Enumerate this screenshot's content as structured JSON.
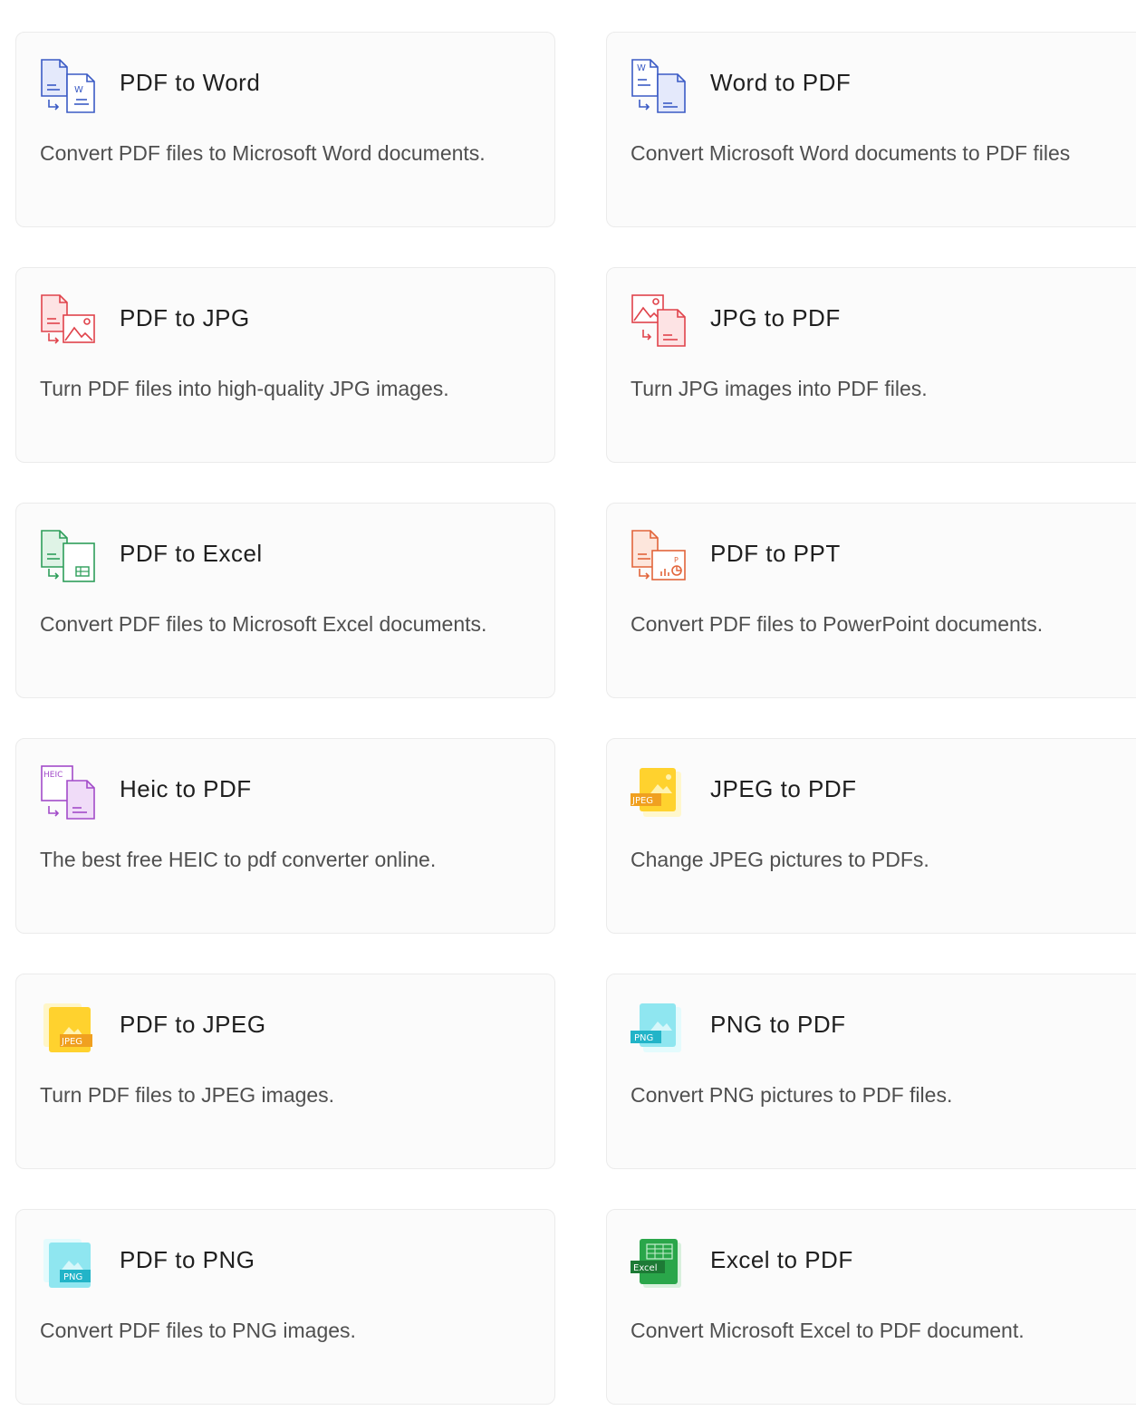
{
  "tools": [
    {
      "title": "PDF to Word",
      "description": "Convert PDF files to Microsoft Word documents.",
      "icon": "pdf-to-word-icon",
      "color": "#3b5bc5"
    },
    {
      "title": "Word to PDF",
      "description": "Convert Microsoft Word documents to PDF files",
      "icon": "word-to-pdf-icon",
      "color": "#3b5bc5"
    },
    {
      "title": "PDF to JPG",
      "description": "Turn PDF files into high-quality JPG images.",
      "icon": "pdf-to-jpg-icon",
      "color": "#e0434b"
    },
    {
      "title": "JPG to PDF",
      "description": "Turn JPG images into PDF files.",
      "icon": "jpg-to-pdf-icon",
      "color": "#e0434b"
    },
    {
      "title": "PDF to Excel",
      "description": "Convert PDF files to Microsoft Excel documents.",
      "icon": "pdf-to-excel-icon",
      "color": "#2e9e5a"
    },
    {
      "title": "PDF to PPT",
      "description": "Convert PDF files to PowerPoint documents.",
      "icon": "pdf-to-ppt-icon",
      "color": "#e2653b"
    },
    {
      "title": "Heic to PDF",
      "description": "The best free HEIC to pdf converter online.",
      "icon": "heic-to-pdf-icon",
      "color": "#a24bc9"
    },
    {
      "title": "JPEG to PDF",
      "description": "Change JPEG pictures to PDFs.",
      "icon": "jpeg-to-pdf-icon",
      "color": "#f4b400"
    },
    {
      "title": "PDF to JPEG",
      "description": "Turn PDF files to JPEG images.",
      "icon": "pdf-to-jpeg-icon",
      "color": "#f4b400"
    },
    {
      "title": "PNG to PDF",
      "description": "Convert PNG pictures to PDF files.",
      "icon": "png-to-pdf-icon",
      "color": "#22b4c8"
    },
    {
      "title": "PDF to PNG",
      "description": "Convert PDF files to PNG images.",
      "icon": "pdf-to-png-icon",
      "color": "#22b4c8"
    },
    {
      "title": "Excel to PDF",
      "description": "Convert Microsoft Excel to PDF document.",
      "icon": "excel-to-pdf-icon",
      "color": "#1d8a3b"
    }
  ],
  "icon_badges": {
    "word": "W",
    "heic": "HEIC",
    "jpeg": "JPEG",
    "png": "PNG",
    "excel": "Excel"
  }
}
